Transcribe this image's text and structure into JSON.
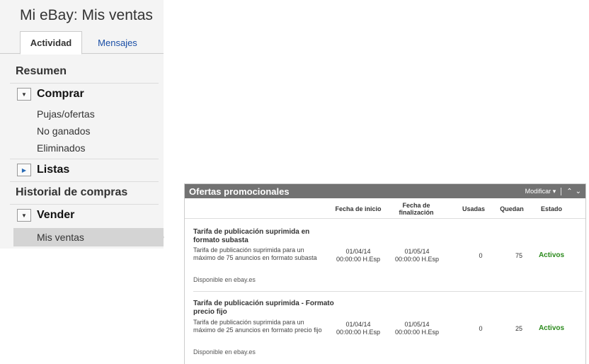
{
  "page": {
    "title": "Mi eBay: Mis ventas"
  },
  "tabs": [
    {
      "label": "Actividad",
      "active": true
    },
    {
      "label": "Mensajes",
      "active": false
    }
  ],
  "nav": {
    "summary": "Resumen",
    "buy": {
      "label": "Comprar",
      "expanded": true,
      "items": [
        "Pujas/ofertas",
        "No ganados",
        "Eliminados"
      ]
    },
    "lists": {
      "label": "Listas",
      "expanded": false
    },
    "history": "Historial de compras",
    "sell": {
      "label": "Vender",
      "expanded": true,
      "items": [
        "Mis ventas"
      ],
      "active_item": "Mis ventas"
    }
  },
  "promos": {
    "title": "Ofertas promocionales",
    "modify_label": "Modificar",
    "columns": {
      "start": "Fecha de inicio",
      "end": "Fecha de finalización",
      "used": "Usadas",
      "remaining": "Quedan",
      "status": "Estado"
    },
    "offers": [
      {
        "title": "Tarifa de publicación suprimida en formato subasta",
        "description": "Tarifa de publicación suprimida para un máximo de 75 anuncios en formato subasta",
        "availability": "Disponible en ebay.es",
        "start_date": "01/04/14",
        "start_time": "00:00:00 H.Esp",
        "end_date": "01/05/14",
        "end_time": "00:00:00 H.Esp",
        "used": "0",
        "remaining": "75",
        "status": "Activos"
      },
      {
        "title": "Tarifa de publicación suprimida - Formato precio fijo",
        "description": "Tarifa de publicación suprimida para un máximo de 25 anuncios en formato precio fijo",
        "availability": "Disponible en ebay.es",
        "start_date": "01/04/14",
        "start_time": "00:00:00 H.Esp",
        "end_date": "01/05/14",
        "end_time": "00:00:00 H.Esp",
        "used": "0",
        "remaining": "25",
        "status": "Activos"
      }
    ]
  },
  "colors": {
    "status_active": "#2b8a1c",
    "panel_header": "#727272",
    "link": "#1a4ea6"
  }
}
